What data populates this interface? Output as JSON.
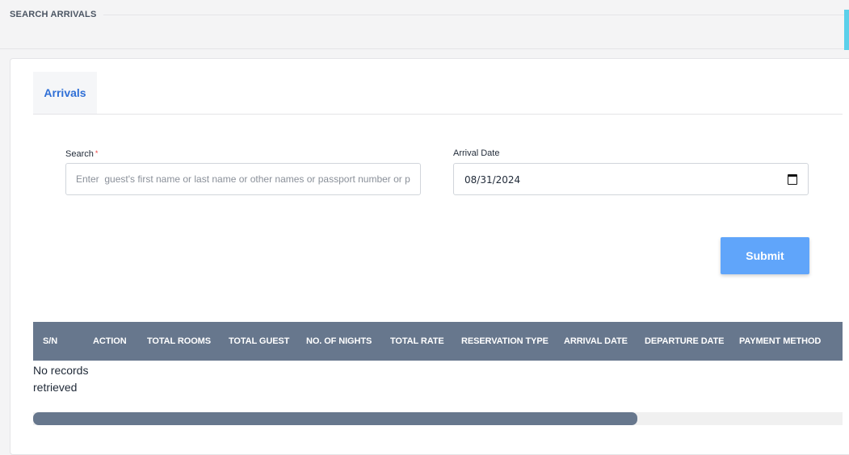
{
  "header": {
    "title": "SEARCH ARRIVALS"
  },
  "tabs": [
    {
      "label": "Arrivals"
    }
  ],
  "form": {
    "search": {
      "label": "Search",
      "required_mark": "*",
      "value": "",
      "placeholder": "Enter  guest's first name or last name or other names or passport number or p"
    },
    "arrival_date": {
      "label": "Arrival Date",
      "value": "08/31/2024"
    },
    "submit_label": "Submit"
  },
  "table": {
    "columns": [
      "S/N",
      "ACTION",
      "TOTAL ROOMS",
      "TOTAL GUEST",
      "NO. OF NIGHTS",
      "TOTAL RATE",
      "RESERVATION TYPE",
      "ARRIVAL DATE",
      "DEPARTURE DATE",
      "PAYMENT METHOD"
    ],
    "empty_message": "No records retrieved"
  },
  "colors": {
    "accent": "#2f6fd6",
    "submit": "#60a5fa",
    "table_header": "#67778d",
    "side_accent": "#5bd0ea"
  },
  "icons": {
    "date_picker": "calendar-icon"
  }
}
